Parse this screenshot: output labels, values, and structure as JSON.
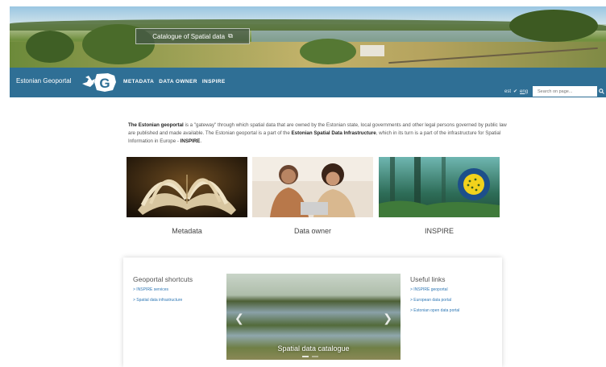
{
  "header": {
    "catalogue_button": "Catalogue of Spatial data",
    "brand": "Estonian Geoportal",
    "nav": [
      "METADATA",
      "DATA OWNER",
      "INSPIRE"
    ],
    "lang_est": "est",
    "lang_eng": "eng",
    "search_placeholder": "Search on page..."
  },
  "intro": {
    "bold1": "The Estonian geoportal",
    "text1": " is a \"gateway\" through which spatial data that are owned by the Estonian state, local governments and other legal persons governed by public law are published and made available. The Estonian geoportal is a part of the ",
    "bold2": "Estonian Spatial Data Infrastructure",
    "text2": ", which in its turn is a part of the infrastructure for Spatial Information in Europe - ",
    "bold3": "INSPIRE",
    "text3": "."
  },
  "cards": [
    "Metadata",
    "Data owner",
    "INSPIRE"
  ],
  "shortcuts": {
    "title": "Geoportal shortcuts",
    "links": [
      "> INSPIRE services",
      "> Spatial data infrastructure"
    ]
  },
  "carousel": {
    "caption": "Spatial data catalogue"
  },
  "useful": {
    "title": "Useful links",
    "links": [
      "> INSPIRE geoportal",
      "> European data portal",
      "> Estonian open data portal"
    ]
  },
  "colors": {
    "navbar": "#2f6f95",
    "link": "#2f78b5"
  },
  "icons": [
    "external-link-icon",
    "geoportal-logo-icon",
    "checkmark-icon",
    "search-icon",
    "chevron-left-icon",
    "chevron-right-icon"
  ]
}
